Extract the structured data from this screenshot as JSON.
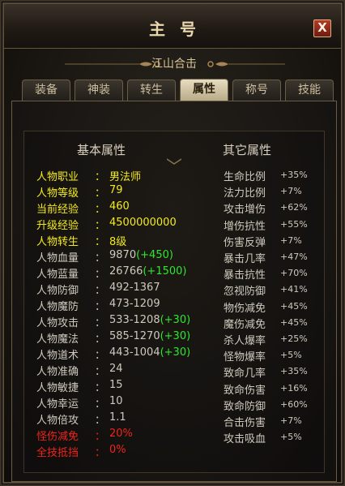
{
  "window": {
    "title": "主号",
    "close_label": "X"
  },
  "subtitle": "江山合击",
  "tabs": [
    {
      "label": "装备",
      "active": false
    },
    {
      "label": "神装",
      "active": false
    },
    {
      "label": "转生",
      "active": false
    },
    {
      "label": "属性",
      "active": true
    },
    {
      "label": "称号",
      "active": false
    },
    {
      "label": "技能",
      "active": false
    }
  ],
  "headers": {
    "basic": "基本属性",
    "other": "其它属性"
  },
  "basic_attributes": [
    {
      "label": "人物职业",
      "value": "男法师",
      "bonus": "",
      "color": "#f2ea1d"
    },
    {
      "label": "人物等级",
      "value": "79",
      "bonus": "",
      "color": "#f2ea1d"
    },
    {
      "label": "当前经验",
      "value": "460",
      "bonus": "",
      "color": "#f2ea1d"
    },
    {
      "label": "升级经验",
      "value": "4500000000",
      "bonus": "",
      "color": "#f2ea1d"
    },
    {
      "label": "人物转生",
      "value": "8级",
      "bonus": "",
      "color": "#f2ea1d"
    },
    {
      "label": "人物血量",
      "value": "9870",
      "bonus": "(+450)",
      "color": "#cfc9bd"
    },
    {
      "label": "人物蓝量",
      "value": "26766",
      "bonus": "(+1500)",
      "color": "#cfc9bd"
    },
    {
      "label": "人物防御",
      "value": "492-1367",
      "bonus": "",
      "color": "#cfc9bd"
    },
    {
      "label": "人物魔防",
      "value": "473-1209",
      "bonus": "",
      "color": "#cfc9bd"
    },
    {
      "label": "人物攻击",
      "value": "533-1208",
      "bonus": "(+30)",
      "color": "#cfc9bd"
    },
    {
      "label": "人物魔法",
      "value": "585-1270",
      "bonus": "(+30)",
      "color": "#cfc9bd"
    },
    {
      "label": "人物道术",
      "value": "443-1004",
      "bonus": "(+30)",
      "color": "#cfc9bd"
    },
    {
      "label": "人物准确",
      "value": "24",
      "bonus": "",
      "color": "#cfc9bd"
    },
    {
      "label": "人物敏捷",
      "value": "15",
      "bonus": "",
      "color": "#cfc9bd"
    },
    {
      "label": "人物幸运",
      "value": "10",
      "bonus": "",
      "color": "#cfc9bd"
    },
    {
      "label": "人物倍攻",
      "value": "1.1",
      "bonus": "",
      "color": "#cfc9bd"
    },
    {
      "label": "怪伤减免",
      "value": "20%",
      "bonus": "",
      "color": "#f0241a"
    },
    {
      "label": "全技抵挡",
      "value": "0%",
      "bonus": "",
      "color": "#f0241a"
    }
  ],
  "other_attributes": [
    {
      "label": "生命比例",
      "value": "+35%"
    },
    {
      "label": "法力比例",
      "value": "+7%"
    },
    {
      "label": "攻击增伤",
      "value": "+62%"
    },
    {
      "label": "增伤抗性",
      "value": "+55%"
    },
    {
      "label": "伤害反弹",
      "value": "+7%"
    },
    {
      "label": "暴击几率",
      "value": "+47%"
    },
    {
      "label": "暴击抗性",
      "value": "+70%"
    },
    {
      "label": "忽视防御",
      "value": "+41%"
    },
    {
      "label": "物伤减免",
      "value": "+45%"
    },
    {
      "label": "魔伤减免",
      "value": "+45%"
    },
    {
      "label": "杀人爆率",
      "value": "+25%"
    },
    {
      "label": "怪物爆率",
      "value": "+5%"
    },
    {
      "label": "致命几率",
      "value": "+35%"
    },
    {
      "label": "致命伤害",
      "value": "+16%"
    },
    {
      "label": "致命防御",
      "value": "+60%"
    },
    {
      "label": "合击伤害",
      "value": "+7%"
    },
    {
      "label": "攻击吸血",
      "value": "+5%"
    }
  ]
}
